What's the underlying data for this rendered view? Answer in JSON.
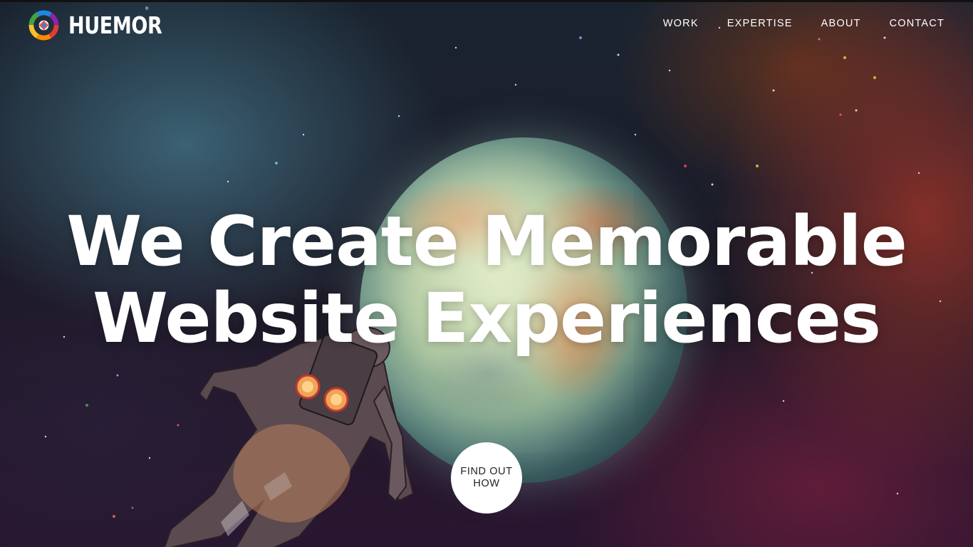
{
  "brand": {
    "name": "HUEMOR",
    "reg_mark": "®"
  },
  "nav": {
    "items": [
      {
        "label": "WORK"
      },
      {
        "label": "EXPERTISE"
      },
      {
        "label": "ABOUT"
      },
      {
        "label": "CONTACT"
      }
    ]
  },
  "hero": {
    "headline_line1": "We Create Memorable",
    "headline_line2": "Website Experiences",
    "cta_label": "FIND OUT HOW"
  },
  "colors": {
    "text": "#ffffff",
    "cta_background": "#ffffff",
    "cta_text": "#222222",
    "logo_ring": [
      "#e53935",
      "#fbc02d",
      "#43a047",
      "#1e88e5",
      "#8e24aa",
      "#fb8c00"
    ]
  },
  "icons": {
    "logo": "huemor-logo-icon"
  }
}
